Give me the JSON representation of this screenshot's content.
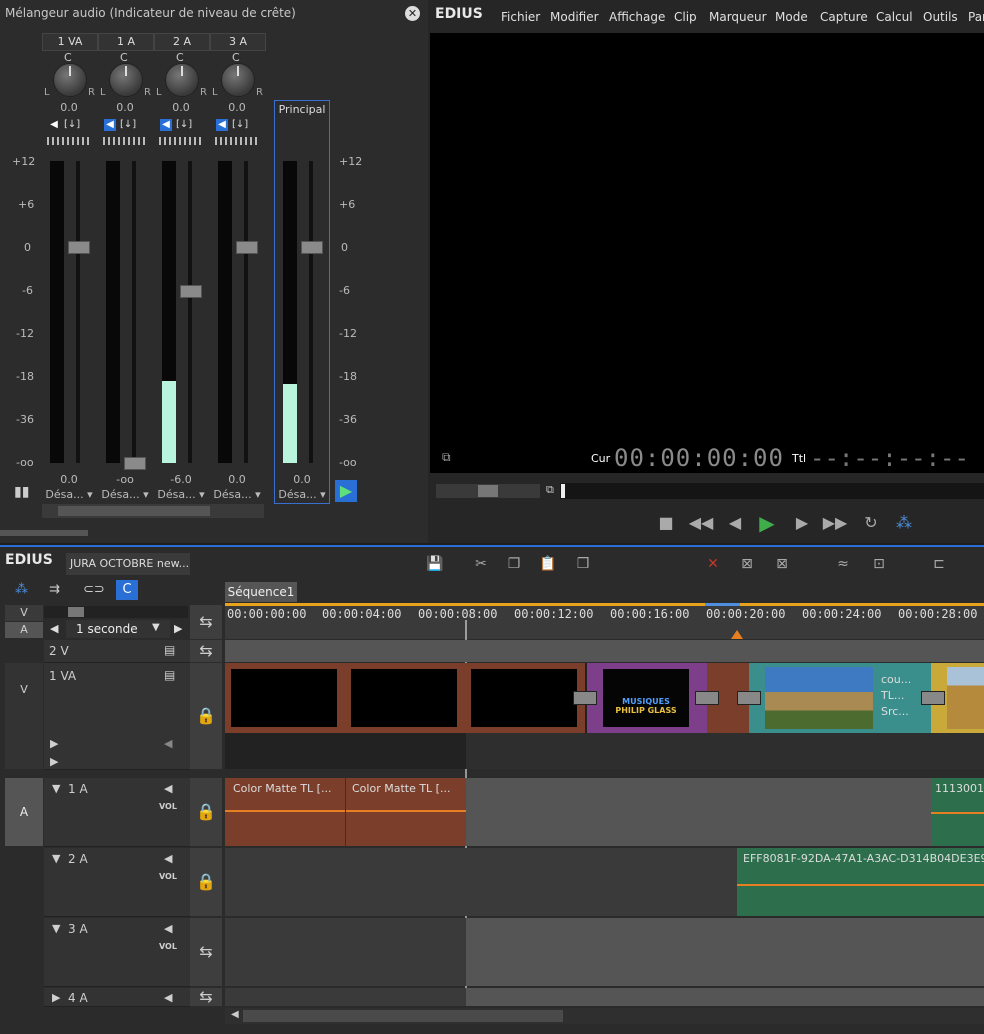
{
  "mixer": {
    "title": "Mélangeur audio (Indicateur de niveau de crête)",
    "channels": [
      {
        "name": "1 VA",
        "pan": "0.0",
        "level": "0.0",
        "mode": "Désa...",
        "meter": 0.0,
        "fader": "0.0",
        "speaker_on": false
      },
      {
        "name": "1 A",
        "pan": "0.0",
        "level": "-oo",
        "mode": "Désa...",
        "meter": 0.0,
        "fader": "-oo",
        "speaker_on": true
      },
      {
        "name": "2 A",
        "pan": "0.0",
        "level": "-6.0",
        "mode": "Désa...",
        "meter": 0.27,
        "fader": "-6.0",
        "speaker_on": true
      },
      {
        "name": "3 A",
        "pan": "0.0",
        "level": "0.0",
        "mode": "Désa...",
        "meter": 0.0,
        "fader": "0.0",
        "speaker_on": true
      }
    ],
    "master": {
      "name": "Principal",
      "level": "0.0",
      "mode": "Désa...",
      "meter": 0.26
    },
    "pan_c": "C",
    "pan_l": "L",
    "pan_r": "R",
    "scale": [
      "+12",
      "+6",
      "0",
      "-6",
      "-12",
      "-18",
      "-36",
      "-oo"
    ]
  },
  "player": {
    "logo": "EDIUS",
    "menu": [
      "Fichier",
      "Modifier",
      "Affichage",
      "Clip",
      "Marqueur",
      "Mode",
      "Capture",
      "Calcul",
      "Outils",
      "Par"
    ],
    "cur_label": "Cur",
    "cur_tc": "00:00:00:00",
    "ttl_label": "Ttl",
    "ttl_tc": "--:--:--:--"
  },
  "timeline": {
    "logo": "EDIUS",
    "project": "JURA OCTOBRE new...",
    "sequence_tab": "Séquence1",
    "zoom": "1 seconde",
    "ruler": [
      "00:00:00:00",
      "00:00:04:00",
      "00:00:08:00",
      "00:00:12:00",
      "00:00:16:00",
      "00:00:20:00",
      "00:00:24:00",
      "00:00:28:00"
    ],
    "track_v": "V",
    "track_a": "A",
    "tracks": [
      {
        "name": "2 V"
      },
      {
        "name": "1 VA"
      },
      {
        "name": "1 A"
      },
      {
        "name": "2 A"
      },
      {
        "name": "3 A"
      },
      {
        "name": "4 A"
      }
    ],
    "vol": "VOL",
    "clips": {
      "cm1": "Color Matte   TL [...",
      "cm2": "Color Matte   TL [...",
      "a1_tail": "1113001",
      "a2_clip": "EFF8081F-92DA-47A1-A3AC-D314B04DE3E9",
      "title_clip_line1": "MUSIQUES",
      "title_clip_line2": "PHILIP GLASS",
      "v_text1": "cou...",
      "v_text2": "TL...",
      "v_text3": "Src..."
    }
  }
}
